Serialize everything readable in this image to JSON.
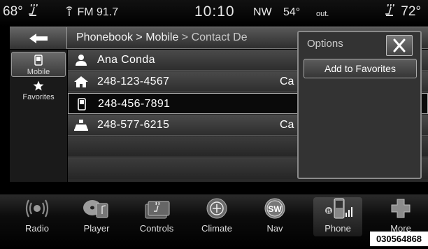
{
  "status": {
    "left_temp": "68°",
    "radio": "FM 91.7",
    "time": "10:10",
    "compass": "NW",
    "outside_temp": "54°",
    "outside_label": "out.",
    "right_temp": "72°"
  },
  "header": {
    "breadcrumb_1": "Phonebook",
    "breadcrumb_2": "> Mobile",
    "breadcrumb_3": "> Contact De"
  },
  "leftnav": {
    "items": [
      {
        "label": "Mobile",
        "icon": "mobile-phone-icon"
      },
      {
        "label": "Favorites",
        "icon": "star-icon"
      }
    ]
  },
  "contact": {
    "rows": [
      {
        "icon": "person-icon",
        "text": "Ana Conda",
        "type": ""
      },
      {
        "icon": "home-icon",
        "text": "248-123-4567",
        "type": "Ca"
      },
      {
        "icon": "mobile-phone-icon",
        "text": "248-456-7891",
        "type": ""
      },
      {
        "icon": "work-icon",
        "text": "248-577-6215",
        "type": "Ca"
      }
    ]
  },
  "options": {
    "title": "Options",
    "add_favorites": "Add to Favorites"
  },
  "dock": {
    "items": [
      {
        "label": "Radio",
        "icon": "radio-icon"
      },
      {
        "label": "Player",
        "icon": "player-icon"
      },
      {
        "label": "Controls",
        "icon": "controls-icon"
      },
      {
        "label": "Climate",
        "icon": "climate-icon"
      },
      {
        "label": "Nav",
        "icon": "nav-icon"
      },
      {
        "label": "Phone",
        "icon": "phone-icon"
      },
      {
        "label": "More",
        "icon": "more-icon"
      }
    ]
  },
  "figure_id": "030564868"
}
